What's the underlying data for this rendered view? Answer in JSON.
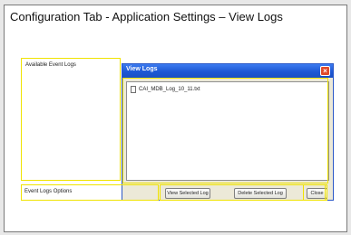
{
  "slide": {
    "title": "Configuration Tab - Application Settings – View Logs",
    "labels": {
      "available_event_logs": "Available Event Logs",
      "event_logs_options": "Event Logs Options"
    }
  },
  "dialog": {
    "title": "View Logs",
    "close_glyph": "×",
    "logs": [
      {
        "name": "CAI_MDB_Log_10_11.txt",
        "icon": "document-icon"
      }
    ],
    "buttons": {
      "view_selected": "View Selected Log",
      "delete_selected": "Delete Selected Log",
      "close": "Close"
    }
  },
  "colors": {
    "highlight": "#f0e300",
    "titlebar": "#1e58d4",
    "window_bg": "#ece9d8",
    "close_button": "#e04a2a"
  }
}
